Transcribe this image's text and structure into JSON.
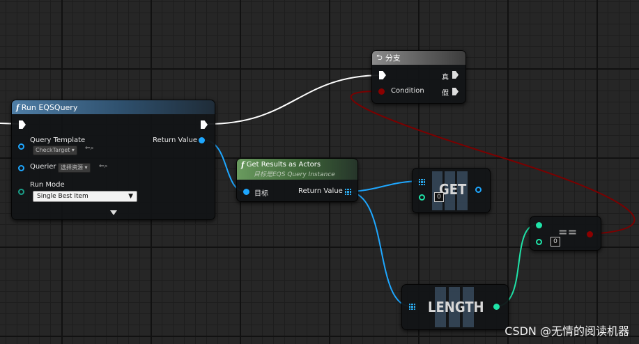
{
  "run_eqs": {
    "title": "Run EQSQuery",
    "query_template_label": "Query Template",
    "query_template_value": "CheckTarget",
    "querier_label": "Querier",
    "querier_value": "选择资源",
    "run_mode_label": "Run Mode",
    "run_mode_value": "Single Best Item",
    "return_value_label": "Return Value"
  },
  "branch": {
    "title": "分支",
    "condition_label": "Condition",
    "true_label": "真",
    "false_label": "假"
  },
  "get_results": {
    "title": "Get Results as Actors",
    "subtitle": "目标是EQS Query Instance",
    "target_label": "目标",
    "return_value_label": "Return Value"
  },
  "get_node": {
    "label": "GET",
    "index_value": "0"
  },
  "length_node": {
    "label": "LENGTH"
  },
  "equal_node": {
    "label": "==",
    "value": "0"
  },
  "watermark": "CSDN @无情的阅读机器",
  "colors": {
    "exec": "#ffffff",
    "object_pin": "#1ea7ff",
    "int_pin": "#1fe3a8",
    "bool_pin": "#8b0000",
    "function_header": "#4f7ea6",
    "pure_header": "#6a9b5f"
  }
}
